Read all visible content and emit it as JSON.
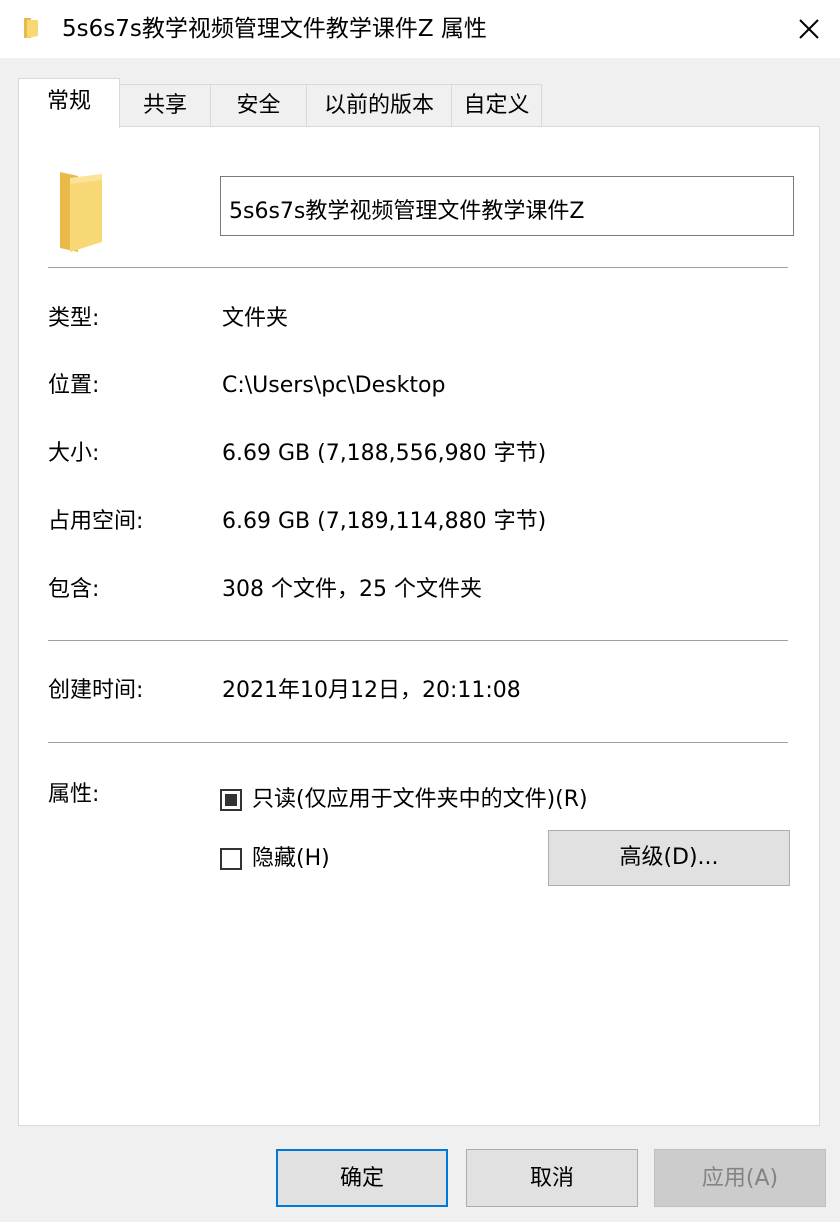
{
  "window": {
    "title": "5s6s7s教学视频管理文件教学课件Z 属性"
  },
  "tabs": [
    {
      "label": "常规",
      "active": true
    },
    {
      "label": "共享",
      "active": false
    },
    {
      "label": "安全",
      "active": false
    },
    {
      "label": "以前的版本",
      "active": false
    },
    {
      "label": "自定义",
      "active": false
    }
  ],
  "general": {
    "name_value": "5s6s7s教学视频管理文件教学课件Z",
    "type_label": "类型:",
    "type_value": "文件夹",
    "location_label": "位置:",
    "location_value": "C:\\Users\\pc\\Desktop",
    "size_label": "大小:",
    "size_value": "6.69 GB (7,188,556,980 字节)",
    "size_on_disk_label": "占用空间:",
    "size_on_disk_value": "6.69 GB (7,189,114,880 字节)",
    "contains_label": "包含:",
    "contains_value": "308 个文件，25 个文件夹",
    "created_label": "创建时间:",
    "created_value": "2021年10月12日，20:11:08",
    "attributes_label": "属性:",
    "readonly_label": "只读(仅应用于文件夹中的文件)(R)",
    "readonly_state": "indeterminate",
    "hidden_label": "隐藏(H)",
    "hidden_checked": false,
    "advanced_label": "高级(D)..."
  },
  "footer": {
    "ok_label": "确定",
    "cancel_label": "取消",
    "apply_label": "应用(A)"
  },
  "colors": {
    "folder_yellow": "#f8d775",
    "folder_dark": "#e9b94a",
    "default_button_border": "#0078d7"
  }
}
